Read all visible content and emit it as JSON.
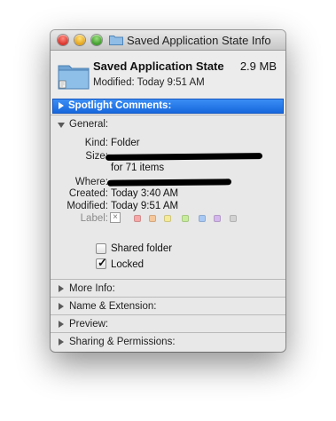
{
  "window": {
    "title": "Saved Application State Info"
  },
  "header": {
    "name": "Saved Application State",
    "size": "2.9 MB",
    "modified": "Modified: Today 9:51 AM"
  },
  "sections": {
    "spotlight": "Spotlight Comments:",
    "general": "General:",
    "more_info": "More Info:",
    "name_extension": "Name & Extension:",
    "preview": "Preview:",
    "sharing": "Sharing & Permissions:"
  },
  "general": {
    "kind_label": "Kind:",
    "kind_value": "Folder",
    "size_label": "Size:",
    "size_items": "for 71 items",
    "where_label": "Where:",
    "created_label": "Created:",
    "created_value": "Today 3:40 AM",
    "modified_label": "Modified:",
    "modified_value": "Today 9:51 AM",
    "label_label": "Label:",
    "label_x": "×",
    "label_colors": [
      "#f6a7a7",
      "#f6c79a",
      "#f4ea98",
      "#c7ec9c",
      "#a8c9f4",
      "#d4b7ec",
      "#d2d2d2"
    ],
    "shared_folder": "Shared folder",
    "shared_checked": false,
    "locked": "Locked",
    "locked_checked": true
  },
  "colors": {
    "selection_blue": "#1667dd",
    "folder_blue": "#7aaedb"
  }
}
